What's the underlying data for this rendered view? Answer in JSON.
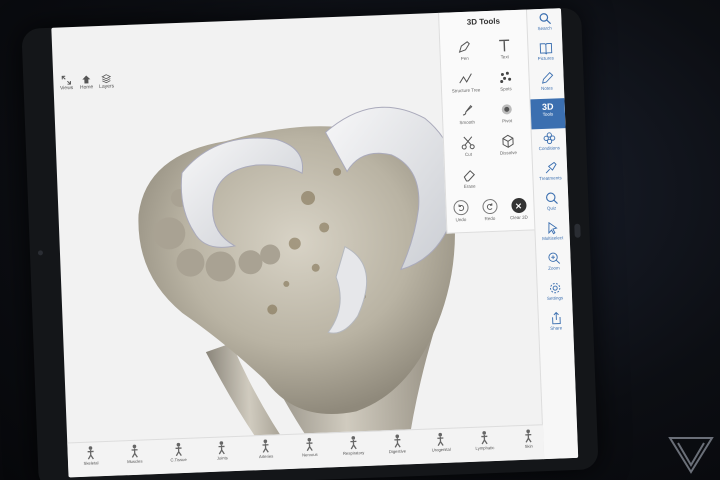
{
  "topbar": {
    "items": [
      {
        "icon": "resize-icon",
        "label": "Views"
      },
      {
        "icon": "home-icon",
        "label": "Home"
      },
      {
        "icon": "layers-icon",
        "label": "Layers"
      }
    ]
  },
  "tools_panel": {
    "title": "3D Tools",
    "tools": [
      {
        "icon": "pen-icon",
        "label": "Pen"
      },
      {
        "icon": "text-icon",
        "label": "Text"
      },
      {
        "icon": "zigzag-icon",
        "label": "Structure Tree"
      },
      {
        "icon": "dots-icon",
        "label": "Spots"
      },
      {
        "icon": "brush-icon",
        "label": "Smooth"
      },
      {
        "icon": "target-icon",
        "label": "Pivot"
      },
      {
        "icon": "scissors-icon",
        "label": "Cut"
      },
      {
        "icon": "cube-icon",
        "label": "Dissolve"
      },
      {
        "icon": "eraser-icon",
        "label": "Erase"
      }
    ],
    "actions": [
      {
        "icon": "undo-icon",
        "label": "Undo"
      },
      {
        "icon": "redo-icon",
        "label": "Redo"
      },
      {
        "icon": "clear-icon",
        "label": "Clear 3D"
      }
    ]
  },
  "sidebar": {
    "items": [
      {
        "icon": "search-icon",
        "label": "Search"
      },
      {
        "icon": "book-icon",
        "label": "Pictures"
      },
      {
        "icon": "pencil-icon",
        "label": "Notes"
      },
      {
        "icon": "3d-icon",
        "label": "Tools",
        "text": "3D",
        "active": true
      },
      {
        "icon": "conditions-icon",
        "label": "Conditions"
      },
      {
        "icon": "treatments-icon",
        "label": "Treatments"
      },
      {
        "icon": "quiz-icon",
        "label": "Quiz"
      },
      {
        "icon": "multiselect-icon",
        "label": "Multiselect"
      },
      {
        "icon": "zoom-icon",
        "label": "Zoom"
      },
      {
        "icon": "settings-icon",
        "label": "Settings"
      },
      {
        "icon": "share-icon",
        "label": "Share"
      }
    ]
  },
  "bottombar": {
    "items": [
      {
        "icon": "skeletal-icon",
        "label": "Skeletal"
      },
      {
        "icon": "muscles-icon",
        "label": "Muscles"
      },
      {
        "icon": "connective-icon",
        "label": "C.Tissue"
      },
      {
        "icon": "joints-icon",
        "label": "Joints"
      },
      {
        "icon": "arteries-icon",
        "label": "Arteries"
      },
      {
        "icon": "nervous-icon",
        "label": "Nervous"
      },
      {
        "icon": "respiratory-icon",
        "label": "Respiratory"
      },
      {
        "icon": "digestive-icon",
        "label": "Digestive"
      },
      {
        "icon": "urogenital-icon",
        "label": "Urogenital"
      },
      {
        "icon": "lymphatic-icon",
        "label": "Lymphatic"
      },
      {
        "icon": "skin-icon",
        "label": "Skin"
      }
    ]
  },
  "colors": {
    "accent": "#3b6fb0",
    "panel_bg": "#fafafa",
    "screen_bg": "#f2f2f2"
  }
}
